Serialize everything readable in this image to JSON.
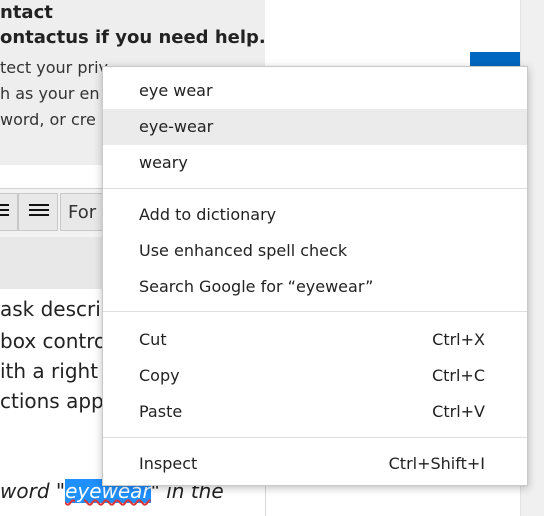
{
  "background": {
    "info_title": "ntact",
    "info_help": "ontactus if you need help.",
    "info_lines": [
      "tect your priv",
      "h as your en",
      "word, or cre"
    ],
    "toolbar_format_label": "For",
    "editor_lines": [
      "ask descrip",
      "box contro",
      "ith a right",
      "ctions app"
    ],
    "editor_italic_prefix": "word \"",
    "editor_highlighted_word": "eyewear",
    "editor_italic_suffix": "\" in the"
  },
  "menu": {
    "suggestions": [
      "eye wear",
      "eye-wear",
      "weary"
    ],
    "spell_items": [
      "Add to dictionary",
      "Use enhanced spell check",
      "Search Google for “eyewear”"
    ],
    "edit_items": [
      {
        "label": "Cut",
        "shortcut": "Ctrl+X"
      },
      {
        "label": "Copy",
        "shortcut": "Ctrl+C"
      },
      {
        "label": "Paste",
        "shortcut": "Ctrl+V"
      }
    ],
    "inspect": {
      "label": "Inspect",
      "shortcut": "Ctrl+Shift+I"
    }
  },
  "colors": {
    "accent": "#0067c0",
    "highlight": "#1e90ff"
  }
}
